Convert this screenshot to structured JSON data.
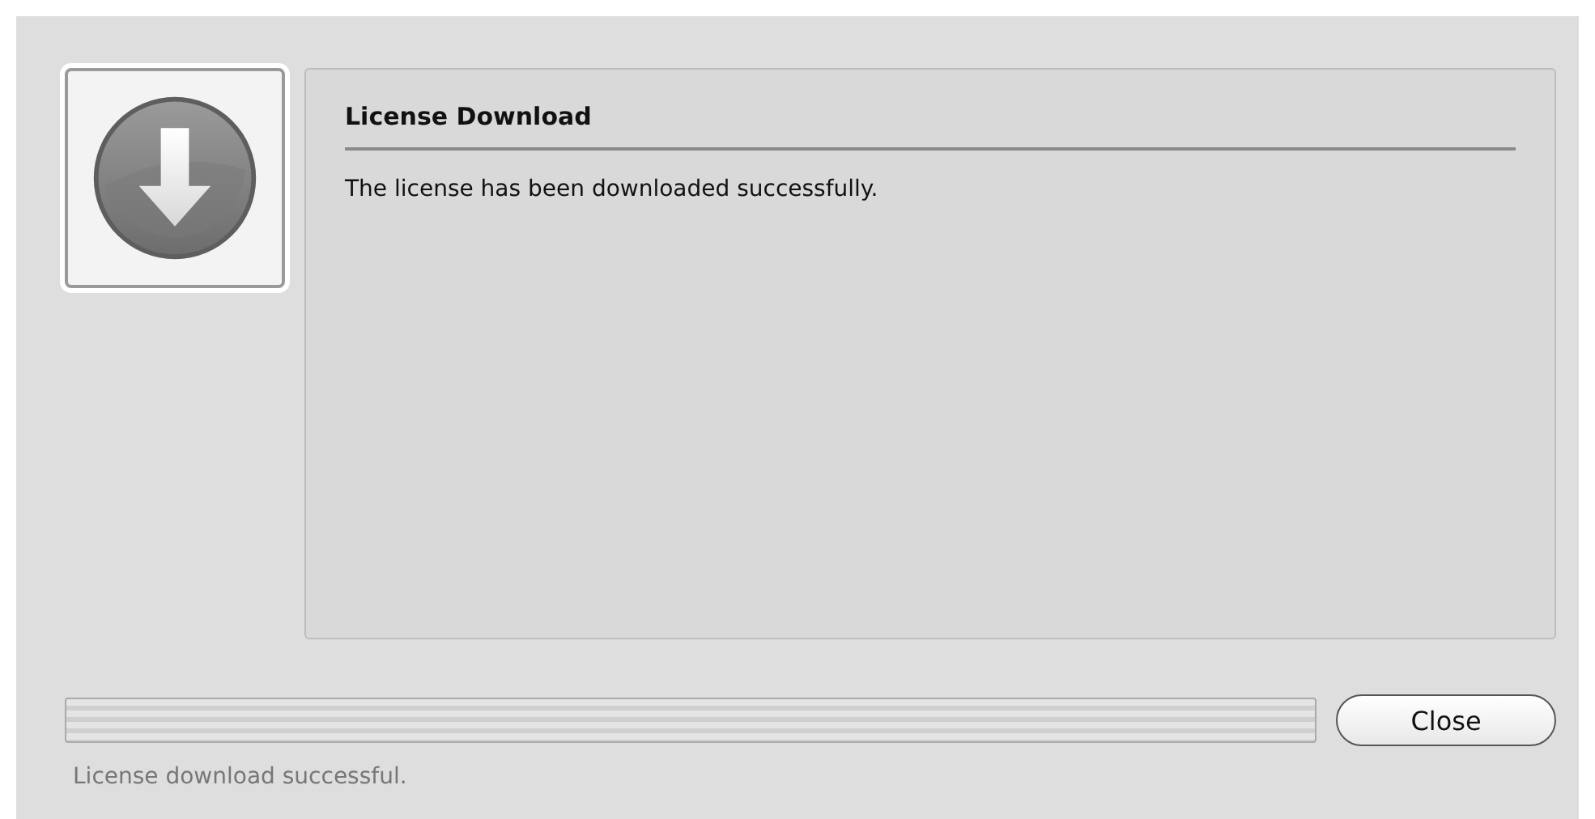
{
  "panel": {
    "title": "License Download",
    "message": "The license has been downloaded successfully."
  },
  "progress": {
    "level": 0
  },
  "buttons": [
    "Close"
  ],
  "status_bar": "License download successful."
}
